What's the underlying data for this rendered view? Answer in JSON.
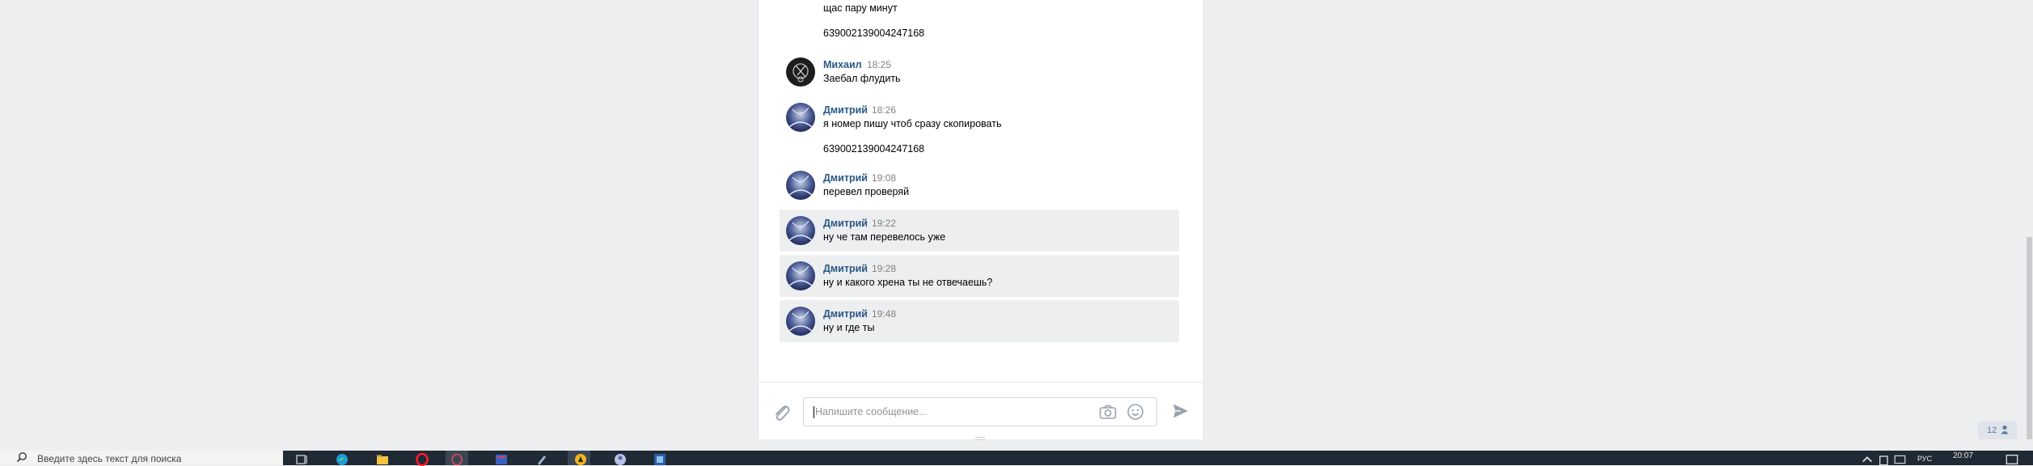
{
  "chat": {
    "top_lines": [
      "щас пару минут",
      "639002139004247168"
    ],
    "messages": [
      {
        "name": "Михаил",
        "time": "18:25",
        "text": "Заебал флудить",
        "extra": "",
        "avatar": "mikhail",
        "highlight": false
      },
      {
        "name": "Дмитрий",
        "time": "18:26",
        "text": "я номер пишу чтоб сразу скопировать",
        "extra": "639002139004247168",
        "avatar": "dmitriy",
        "highlight": false
      },
      {
        "name": "Дмитрий",
        "time": "19:08",
        "text": "перевел проверяй",
        "extra": "",
        "avatar": "dmitriy",
        "highlight": false
      },
      {
        "name": "Дмитрий",
        "time": "19:22",
        "text": "ну че там перевелось уже",
        "extra": "",
        "avatar": "dmitriy",
        "highlight": true
      },
      {
        "name": "Дмитрий",
        "time": "19:28",
        "text": "ну и какого хрена ты не отвечаешь?",
        "extra": "",
        "avatar": "dmitriy",
        "highlight": true
      },
      {
        "name": "Дмитрий",
        "time": "19:48",
        "text": "ну и где ты",
        "extra": "",
        "avatar": "dmitriy",
        "highlight": true
      }
    ]
  },
  "composer": {
    "placeholder": "Напишите сообщение...",
    "icons": [
      "paperclip-icon",
      "camera-icon",
      "smiley-icon",
      "send-icon"
    ]
  },
  "online_badge": {
    "count": "12"
  },
  "taskbar": {
    "search_placeholder": "Введите здесь текст для поиска",
    "language": "РУС",
    "clock": "20:07"
  },
  "colors": {
    "page_bg": "#edeef0",
    "name_link": "#2a5885",
    "time": "#828282",
    "highlight_row": "#edeef0",
    "taskbar": "#202a35"
  }
}
